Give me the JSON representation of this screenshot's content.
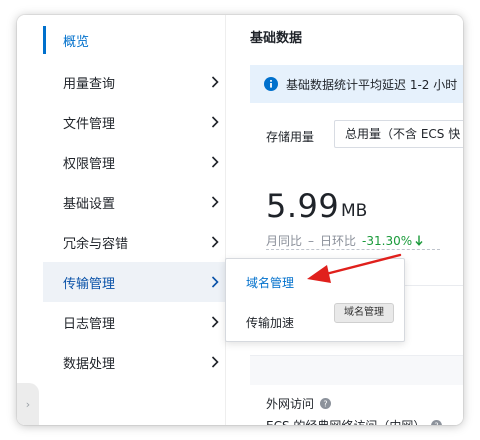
{
  "sidebar": {
    "items": [
      {
        "label": "概览"
      },
      {
        "label": "用量查询"
      },
      {
        "label": "文件管理"
      },
      {
        "label": "权限管理"
      },
      {
        "label": "基础设置"
      },
      {
        "label": "冗余与容错"
      },
      {
        "label": "传输管理"
      },
      {
        "label": "日志管理"
      },
      {
        "label": "数据处理"
      }
    ],
    "collapse_glyph": "›"
  },
  "main": {
    "title": "基础数据",
    "notice": "基础数据统计平均延迟 1-2 小时",
    "storage_label": "存储用量",
    "storage_select_value": "总用量（不含 ECS 快",
    "usage_value": "5.99",
    "usage_unit": "MB",
    "yoy_label": "月同比",
    "yoy_value": "–",
    "mom_label": "日环比",
    "mom_value": "-31.30%",
    "public_access_label": "外网访问",
    "ecs_access_label": "ECS 的经典网络访问（内网）"
  },
  "submenu": {
    "items": [
      {
        "label": "域名管理"
      },
      {
        "label": "传输加速"
      }
    ],
    "tooltip": "域名管理"
  },
  "colors": {
    "accent": "#0070cc",
    "notice_bg": "#e6f1fc",
    "positive": "#1a9a3a",
    "annotation": "#e0201c"
  }
}
